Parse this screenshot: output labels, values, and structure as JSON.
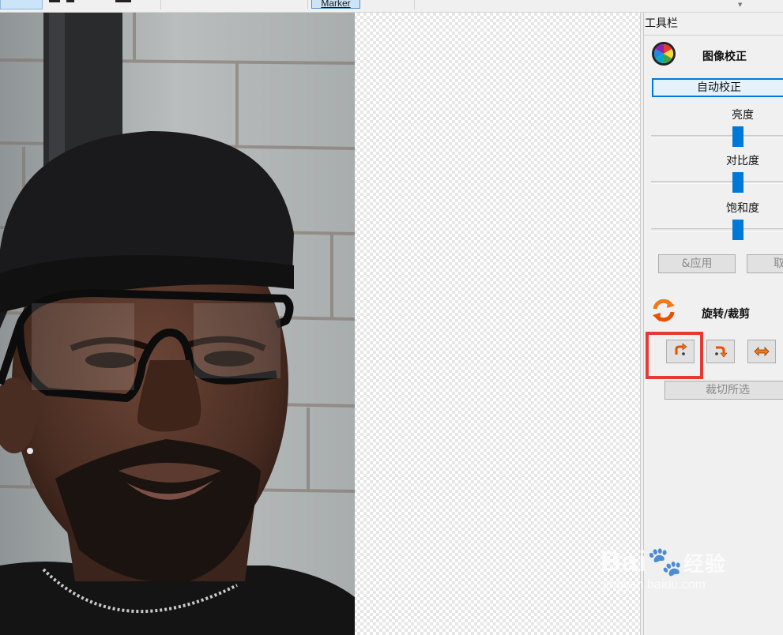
{
  "toolbar": {
    "marker_label": "Marker"
  },
  "panel": {
    "header": "工具栏",
    "image_correction": {
      "title": "图像校正",
      "icon": "color-wheel-icon",
      "auto_label": "自动校正",
      "sliders": [
        {
          "label": "亮度",
          "value": 0.5
        },
        {
          "label": "对比度",
          "value": 0.5
        },
        {
          "label": "饱和度",
          "value": 0.5
        }
      ],
      "apply_label": "&应用",
      "cancel_label": "取"
    },
    "rotate_crop": {
      "title": "旋转/裁剪",
      "icon": "rotate-arrows-icon",
      "buttons": [
        {
          "name": "rotate-left-icon"
        },
        {
          "name": "rotate-right-icon"
        },
        {
          "name": "flip-horizontal-icon"
        }
      ],
      "crop_label": "裁切所选"
    }
  },
  "watermark": {
    "brand": "Bai",
    "suffix": "经验",
    "url": "jingyan.baidu.com"
  },
  "colors": {
    "accent": "#0078d7",
    "highlight": "#e53935",
    "icon_orange": "#f07a1a"
  }
}
